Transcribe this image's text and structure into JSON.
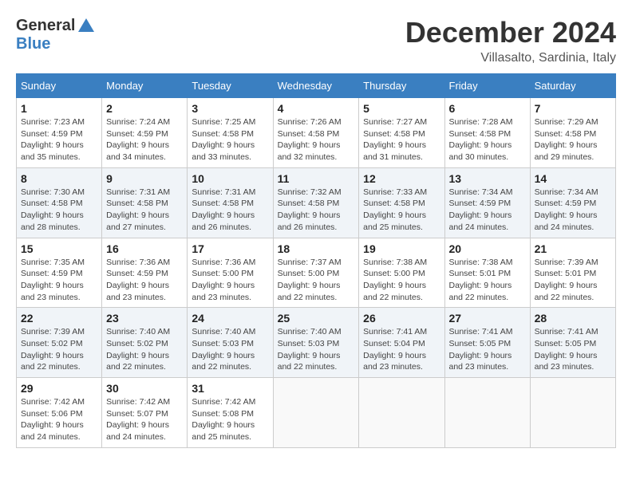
{
  "header": {
    "logo_general": "General",
    "logo_blue": "Blue",
    "month_year": "December 2024",
    "location": "Villasalto, Sardinia, Italy"
  },
  "weekdays": [
    "Sunday",
    "Monday",
    "Tuesday",
    "Wednesday",
    "Thursday",
    "Friday",
    "Saturday"
  ],
  "weeks": [
    [
      {
        "day": "1",
        "sunrise": "Sunrise: 7:23 AM",
        "sunset": "Sunset: 4:59 PM",
        "daylight": "Daylight: 9 hours and 35 minutes."
      },
      {
        "day": "2",
        "sunrise": "Sunrise: 7:24 AM",
        "sunset": "Sunset: 4:59 PM",
        "daylight": "Daylight: 9 hours and 34 minutes."
      },
      {
        "day": "3",
        "sunrise": "Sunrise: 7:25 AM",
        "sunset": "Sunset: 4:58 PM",
        "daylight": "Daylight: 9 hours and 33 minutes."
      },
      {
        "day": "4",
        "sunrise": "Sunrise: 7:26 AM",
        "sunset": "Sunset: 4:58 PM",
        "daylight": "Daylight: 9 hours and 32 minutes."
      },
      {
        "day": "5",
        "sunrise": "Sunrise: 7:27 AM",
        "sunset": "Sunset: 4:58 PM",
        "daylight": "Daylight: 9 hours and 31 minutes."
      },
      {
        "day": "6",
        "sunrise": "Sunrise: 7:28 AM",
        "sunset": "Sunset: 4:58 PM",
        "daylight": "Daylight: 9 hours and 30 minutes."
      },
      {
        "day": "7",
        "sunrise": "Sunrise: 7:29 AM",
        "sunset": "Sunset: 4:58 PM",
        "daylight": "Daylight: 9 hours and 29 minutes."
      }
    ],
    [
      {
        "day": "8",
        "sunrise": "Sunrise: 7:30 AM",
        "sunset": "Sunset: 4:58 PM",
        "daylight": "Daylight: 9 hours and 28 minutes."
      },
      {
        "day": "9",
        "sunrise": "Sunrise: 7:31 AM",
        "sunset": "Sunset: 4:58 PM",
        "daylight": "Daylight: 9 hours and 27 minutes."
      },
      {
        "day": "10",
        "sunrise": "Sunrise: 7:31 AM",
        "sunset": "Sunset: 4:58 PM",
        "daylight": "Daylight: 9 hours and 26 minutes."
      },
      {
        "day": "11",
        "sunrise": "Sunrise: 7:32 AM",
        "sunset": "Sunset: 4:58 PM",
        "daylight": "Daylight: 9 hours and 26 minutes."
      },
      {
        "day": "12",
        "sunrise": "Sunrise: 7:33 AM",
        "sunset": "Sunset: 4:58 PM",
        "daylight": "Daylight: 9 hours and 25 minutes."
      },
      {
        "day": "13",
        "sunrise": "Sunrise: 7:34 AM",
        "sunset": "Sunset: 4:59 PM",
        "daylight": "Daylight: 9 hours and 24 minutes."
      },
      {
        "day": "14",
        "sunrise": "Sunrise: 7:34 AM",
        "sunset": "Sunset: 4:59 PM",
        "daylight": "Daylight: 9 hours and 24 minutes."
      }
    ],
    [
      {
        "day": "15",
        "sunrise": "Sunrise: 7:35 AM",
        "sunset": "Sunset: 4:59 PM",
        "daylight": "Daylight: 9 hours and 23 minutes."
      },
      {
        "day": "16",
        "sunrise": "Sunrise: 7:36 AM",
        "sunset": "Sunset: 4:59 PM",
        "daylight": "Daylight: 9 hours and 23 minutes."
      },
      {
        "day": "17",
        "sunrise": "Sunrise: 7:36 AM",
        "sunset": "Sunset: 5:00 PM",
        "daylight": "Daylight: 9 hours and 23 minutes."
      },
      {
        "day": "18",
        "sunrise": "Sunrise: 7:37 AM",
        "sunset": "Sunset: 5:00 PM",
        "daylight": "Daylight: 9 hours and 22 minutes."
      },
      {
        "day": "19",
        "sunrise": "Sunrise: 7:38 AM",
        "sunset": "Sunset: 5:00 PM",
        "daylight": "Daylight: 9 hours and 22 minutes."
      },
      {
        "day": "20",
        "sunrise": "Sunrise: 7:38 AM",
        "sunset": "Sunset: 5:01 PM",
        "daylight": "Daylight: 9 hours and 22 minutes."
      },
      {
        "day": "21",
        "sunrise": "Sunrise: 7:39 AM",
        "sunset": "Sunset: 5:01 PM",
        "daylight": "Daylight: 9 hours and 22 minutes."
      }
    ],
    [
      {
        "day": "22",
        "sunrise": "Sunrise: 7:39 AM",
        "sunset": "Sunset: 5:02 PM",
        "daylight": "Daylight: 9 hours and 22 minutes."
      },
      {
        "day": "23",
        "sunrise": "Sunrise: 7:40 AM",
        "sunset": "Sunset: 5:02 PM",
        "daylight": "Daylight: 9 hours and 22 minutes."
      },
      {
        "day": "24",
        "sunrise": "Sunrise: 7:40 AM",
        "sunset": "Sunset: 5:03 PM",
        "daylight": "Daylight: 9 hours and 22 minutes."
      },
      {
        "day": "25",
        "sunrise": "Sunrise: 7:40 AM",
        "sunset": "Sunset: 5:03 PM",
        "daylight": "Daylight: 9 hours and 22 minutes."
      },
      {
        "day": "26",
        "sunrise": "Sunrise: 7:41 AM",
        "sunset": "Sunset: 5:04 PM",
        "daylight": "Daylight: 9 hours and 23 minutes."
      },
      {
        "day": "27",
        "sunrise": "Sunrise: 7:41 AM",
        "sunset": "Sunset: 5:05 PM",
        "daylight": "Daylight: 9 hours and 23 minutes."
      },
      {
        "day": "28",
        "sunrise": "Sunrise: 7:41 AM",
        "sunset": "Sunset: 5:05 PM",
        "daylight": "Daylight: 9 hours and 23 minutes."
      }
    ],
    [
      {
        "day": "29",
        "sunrise": "Sunrise: 7:42 AM",
        "sunset": "Sunset: 5:06 PM",
        "daylight": "Daylight: 9 hours and 24 minutes."
      },
      {
        "day": "30",
        "sunrise": "Sunrise: 7:42 AM",
        "sunset": "Sunset: 5:07 PM",
        "daylight": "Daylight: 9 hours and 24 minutes."
      },
      {
        "day": "31",
        "sunrise": "Sunrise: 7:42 AM",
        "sunset": "Sunset: 5:08 PM",
        "daylight": "Daylight: 9 hours and 25 minutes."
      },
      null,
      null,
      null,
      null
    ]
  ]
}
